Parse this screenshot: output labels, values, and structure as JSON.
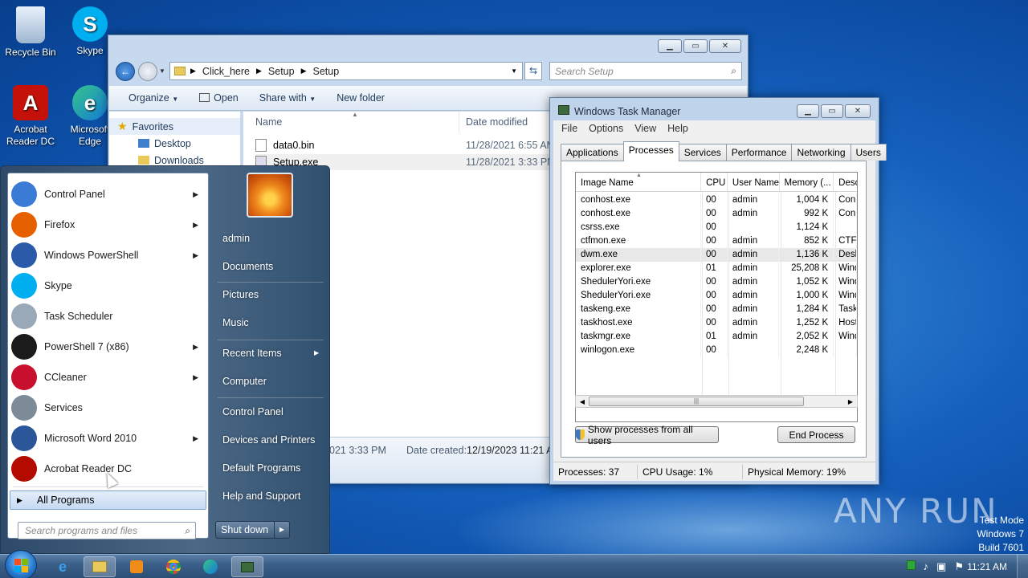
{
  "desktop": {
    "icons": [
      {
        "label": "Recycle Bin",
        "icon": "recycle-bin-icon"
      },
      {
        "label": "Skype",
        "icon": "skype-icon"
      },
      {
        "label": "Acrobat Reader DC",
        "icon": "acrobat-icon"
      },
      {
        "label": "Microsoft Edge",
        "icon": "edge-icon"
      }
    ],
    "watermark": {
      "brand": "ANY RUN",
      "line1": "Test Mode",
      "line2": "Windows 7",
      "line3": "Build 7601"
    }
  },
  "explorer": {
    "breadcrumb": [
      "Click_here",
      "Setup",
      "Setup"
    ],
    "search_placeholder": "Search Setup",
    "toolbar": [
      "Organize",
      "Open",
      "Share with",
      "New folder"
    ],
    "nav": {
      "favorites": "Favorites",
      "items": [
        "Desktop",
        "Downloads"
      ]
    },
    "columns": {
      "name": "Name",
      "date": "Date modified"
    },
    "files": [
      {
        "name": "data0.bin",
        "date": "11/28/2021 6:55 AM"
      },
      {
        "name": "Setup.exe",
        "date": "11/28/2021 3:33 PM"
      }
    ],
    "details": {
      "modified_suffix": "021 3:33 PM",
      "created_label": "Date created:",
      "created_value": "12/19/2023 11:21 AM"
    }
  },
  "taskmanager": {
    "title": "Windows Task Manager",
    "menu": [
      "File",
      "Options",
      "View",
      "Help"
    ],
    "tabs": [
      "Applications",
      "Processes",
      "Services",
      "Performance",
      "Networking",
      "Users"
    ],
    "columns": [
      "Image Name",
      "CPU",
      "User Name",
      "Memory (...",
      "Desc"
    ],
    "rows": [
      {
        "name": "conhost.exe",
        "cpu": "00",
        "user": "admin",
        "mem": "1,004 K",
        "desc": "Con"
      },
      {
        "name": "conhost.exe",
        "cpu": "00",
        "user": "admin",
        "mem": "992 K",
        "desc": "Con"
      },
      {
        "name": "csrss.exe",
        "cpu": "00",
        "user": "",
        "mem": "1,124 K",
        "desc": ""
      },
      {
        "name": "ctfmon.exe",
        "cpu": "00",
        "user": "admin",
        "mem": "852 K",
        "desc": "CTF"
      },
      {
        "name": "dwm.exe",
        "cpu": "00",
        "user": "admin",
        "mem": "1,136 K",
        "desc": "Desk"
      },
      {
        "name": "explorer.exe",
        "cpu": "01",
        "user": "admin",
        "mem": "25,208 K",
        "desc": "Wind"
      },
      {
        "name": "ShedulerYori.exe",
        "cpu": "00",
        "user": "admin",
        "mem": "1,052 K",
        "desc": "Wind"
      },
      {
        "name": "ShedulerYori.exe",
        "cpu": "00",
        "user": "admin",
        "mem": "1,000 K",
        "desc": "Wind"
      },
      {
        "name": "taskeng.exe",
        "cpu": "00",
        "user": "admin",
        "mem": "1,284 K",
        "desc": "Task"
      },
      {
        "name": "taskhost.exe",
        "cpu": "00",
        "user": "admin",
        "mem": "1,252 K",
        "desc": "Host"
      },
      {
        "name": "taskmgr.exe",
        "cpu": "01",
        "user": "admin",
        "mem": "2,052 K",
        "desc": "Wind"
      },
      {
        "name": "winlogon.exe",
        "cpu": "00",
        "user": "",
        "mem": "2,248 K",
        "desc": ""
      }
    ],
    "show_all_button": "Show processes from all users",
    "end_button": "End Process",
    "status": {
      "processes": "Processes: 37",
      "cpu": "CPU Usage: 1%",
      "memory": "Physical Memory: 19%"
    }
  },
  "startmenu": {
    "programs": [
      {
        "label": "Control Panel",
        "icon": "control-panel-icon",
        "submenu": true,
        "color": "#3a7bd5"
      },
      {
        "label": "Firefox",
        "icon": "firefox-icon",
        "submenu": true,
        "color": "#e66000"
      },
      {
        "label": "Windows PowerShell",
        "icon": "powershell-icon",
        "submenu": true,
        "color": "#2a5aa8"
      },
      {
        "label": "Skype",
        "icon": "skype-icon",
        "submenu": false,
        "color": "#00aff0"
      },
      {
        "label": "Task Scheduler",
        "icon": "task-scheduler-icon",
        "submenu": false,
        "color": "#9aa9b8"
      },
      {
        "label": "PowerShell 7 (x86)",
        "icon": "powershell7-icon",
        "submenu": true,
        "color": "#1b1b1b"
      },
      {
        "label": "CCleaner",
        "icon": "ccleaner-icon",
        "submenu": true,
        "color": "#c8102e"
      },
      {
        "label": "Services",
        "icon": "services-icon",
        "submenu": false,
        "color": "#7d8b99"
      },
      {
        "label": "Microsoft Word 2010",
        "icon": "word-icon",
        "submenu": true,
        "color": "#2b579a"
      },
      {
        "label": "Acrobat Reader DC",
        "icon": "acrobat-icon",
        "submenu": false,
        "color": "#b30b00"
      }
    ],
    "all_programs": "All Programs",
    "search_placeholder": "Search programs and files",
    "right_items": [
      "admin",
      "Documents",
      "Pictures",
      "Music",
      "Recent Items",
      "Computer",
      "Control Panel",
      "Devices and Printers",
      "Default Programs",
      "Help and Support"
    ],
    "shutdown": "Shut down"
  },
  "taskbar": {
    "items": [
      "ie-icon",
      "explorer-icon",
      "media-player-icon",
      "chrome-icon",
      "edge-icon",
      "task-manager-icon"
    ],
    "clock": "11:21 AM"
  }
}
